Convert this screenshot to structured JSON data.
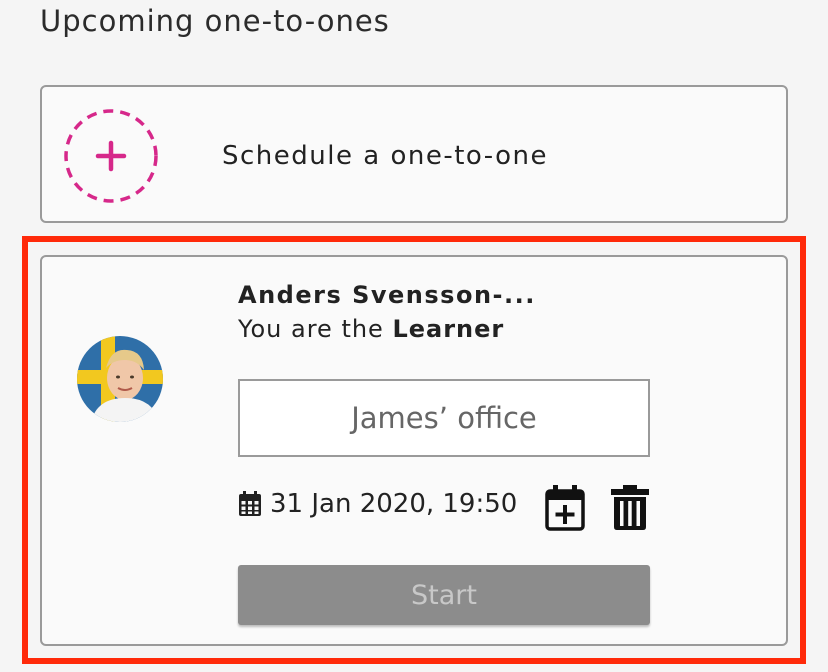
{
  "section": {
    "title": "Upcoming one-to-ones"
  },
  "schedule": {
    "label": "Schedule a one-to-one",
    "icon": "add-circle-icon",
    "accent_color": "#d6288a"
  },
  "meeting": {
    "person_name": "Anders Svensson-...",
    "role_prefix": "You are the ",
    "role": "Learner",
    "location": "James’ office",
    "datetime": "31 Jan 2020, 19:50",
    "start_label": "Start",
    "icons": {
      "date": "calendar-icon",
      "add_to_calendar": "calendar-plus-icon",
      "delete": "trash-icon"
    },
    "highlight_color": "#ff2a0a"
  }
}
